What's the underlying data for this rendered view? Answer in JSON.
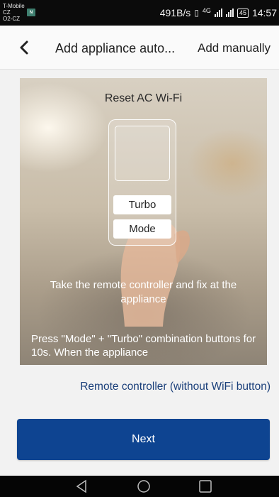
{
  "status_bar": {
    "carrier_line1": "T-Mobile CZ",
    "carrier_line2": "O2-CZ",
    "sim_icon_label": "N",
    "speed": "491B/s",
    "network_type": "4G",
    "battery": "45",
    "time": "14:57"
  },
  "header": {
    "back_icon": "chevron-left-icon",
    "title": "Add appliance auto...",
    "action_label": "Add manually"
  },
  "illustration": {
    "title": "Reset AC Wi-Fi",
    "remote_buttons": [
      "Turbo",
      "Mode"
    ],
    "caption": "Take the remote controller and fix at the appliance",
    "instruction": "Press \"Mode\" + \"Turbo\" combination buttons for 10s. When the appliance"
  },
  "remote_link": "Remote controller (without WiFi button)",
  "next_button": "Next",
  "nav": {
    "back_icon": "triangle-back-icon",
    "home_icon": "circle-home-icon",
    "recent_icon": "square-recent-icon"
  },
  "colors": {
    "primary": "#0e4491",
    "link": "#1a3f7a",
    "status_bar": "#0b0b0b"
  }
}
